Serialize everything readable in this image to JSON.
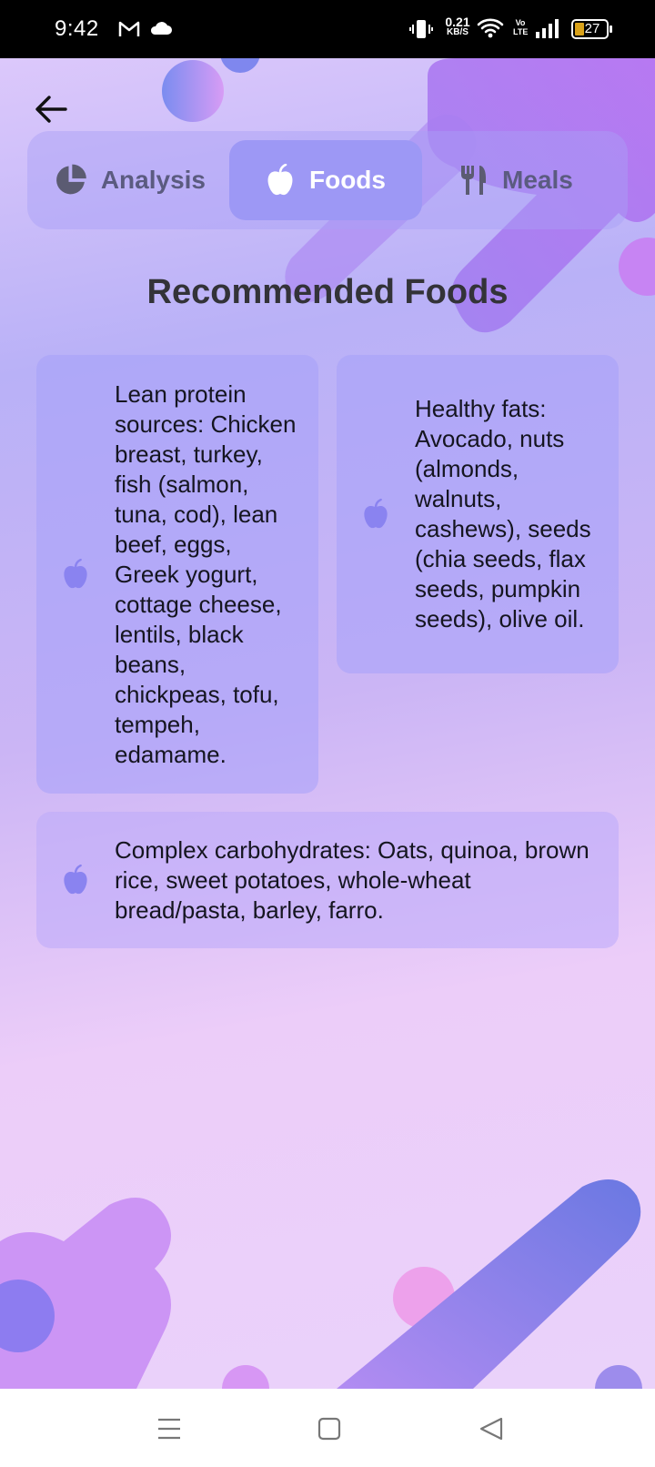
{
  "status_bar": {
    "time": "9:42",
    "net_speed_value": "0.21",
    "net_speed_unit": "KB/S",
    "volte": "Vo LTE",
    "battery": "27",
    "icons": [
      "gmail-icon",
      "cloud-icon",
      "vibrate-icon",
      "wifi-icon",
      "signal-icon",
      "battery-icon"
    ]
  },
  "header": {
    "back_icon": "arrow-left-icon"
  },
  "tabs": [
    {
      "label": "Analysis",
      "icon": "pie-chart-icon",
      "active": false
    },
    {
      "label": "Foods",
      "icon": "apple-icon",
      "active": true
    },
    {
      "label": "Meals",
      "icon": "utensils-icon",
      "active": false
    }
  ],
  "page": {
    "title": "Recommended Foods"
  },
  "cards": [
    {
      "icon": "apple-icon",
      "text": "Lean protein sources: Chicken breast, turkey, fish (salmon, tuna, cod), lean beef, eggs, Greek yogurt, cottage cheese, lentils, black beans, chickpeas, tofu, tempeh, edamame."
    },
    {
      "icon": "apple-icon",
      "text": "Healthy fats: Avocado, nuts (almonds, walnuts, cashews), seeds (chia seeds, flax seeds, pumpkin seeds), olive oil."
    },
    {
      "icon": "apple-icon",
      "text": "Complex carbohydrates: Oats, quinoa, brown rice, sweet potatoes, whole-wheat bread/pasta, barley, farro."
    }
  ],
  "nav_bar": {
    "icons": [
      "menu-icon",
      "home-square-icon",
      "back-triangle-icon"
    ]
  },
  "colors": {
    "accent": "#9d98f5",
    "card_icon": "#8a83f0",
    "text_dark": "#333338"
  }
}
